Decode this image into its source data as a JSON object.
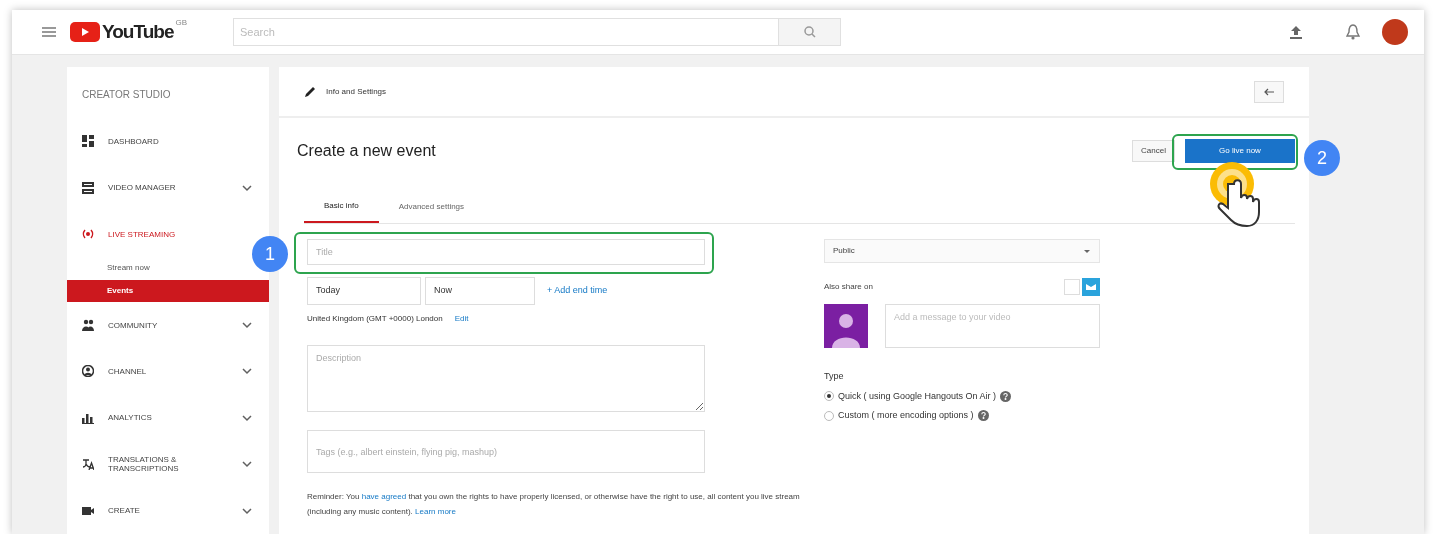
{
  "header": {
    "logo_text": "YouTube",
    "logo_region": "GB",
    "search": {
      "placeholder": "Search"
    }
  },
  "sidebar": {
    "title": "CREATOR STUDIO",
    "items": [
      {
        "label": "DASHBOARD",
        "expandable": false,
        "active": false
      },
      {
        "label": "VIDEO MANAGER",
        "expandable": true,
        "active": false
      },
      {
        "label": "LIVE STREAMING",
        "expandable": false,
        "active": true,
        "children": [
          {
            "label": "Stream now",
            "selected": false
          },
          {
            "label": "Events",
            "selected": true
          }
        ]
      },
      {
        "label": "COMMUNITY",
        "expandable": true,
        "active": false
      },
      {
        "label": "CHANNEL",
        "expandable": true,
        "active": false
      },
      {
        "label": "ANALYTICS",
        "expandable": true,
        "active": false
      },
      {
        "label": "TRANSLATIONS & TRANSCRIPTIONS",
        "expandable": true,
        "active": false
      },
      {
        "label": "CREATE",
        "expandable": true,
        "active": false
      }
    ]
  },
  "topbar": {
    "label": "Info and Settings"
  },
  "page_title": "Create a new event",
  "buttons": {
    "cancel": "Cancel",
    "primary": "Go live now"
  },
  "tabs": [
    {
      "label": "Basic info",
      "selected": true
    },
    {
      "label": "Advanced settings",
      "selected": false
    }
  ],
  "form": {
    "title": {
      "placeholder": "Title"
    },
    "date": "Today",
    "time": "Now",
    "add_end_time": "+ Add end time",
    "timezone": "United Kingdom (GMT +0000) London",
    "timezone_edit": "Edit",
    "description": {
      "placeholder": "Description"
    },
    "tags": {
      "placeholder": "Tags (e.g., albert einstein, flying pig, mashup)"
    },
    "reminder": "Reminder: You **have agreed** that you own the rights to have properly licensed, or otherwise have the right to use, all content you live stream (including any music content).",
    "learn_more": "Learn more"
  },
  "right": {
    "privacy": "Public",
    "share_label": "Also share on",
    "share_checked": false,
    "message": {
      "placeholder": "Add a message to your video"
    },
    "type_label": "Type",
    "types": [
      {
        "label": "Quick ( using Google Hangouts On Air )",
        "selected": true
      },
      {
        "label": "Custom ( more encoding options )",
        "selected": false
      }
    ]
  },
  "steps": [
    "1",
    "2"
  ]
}
